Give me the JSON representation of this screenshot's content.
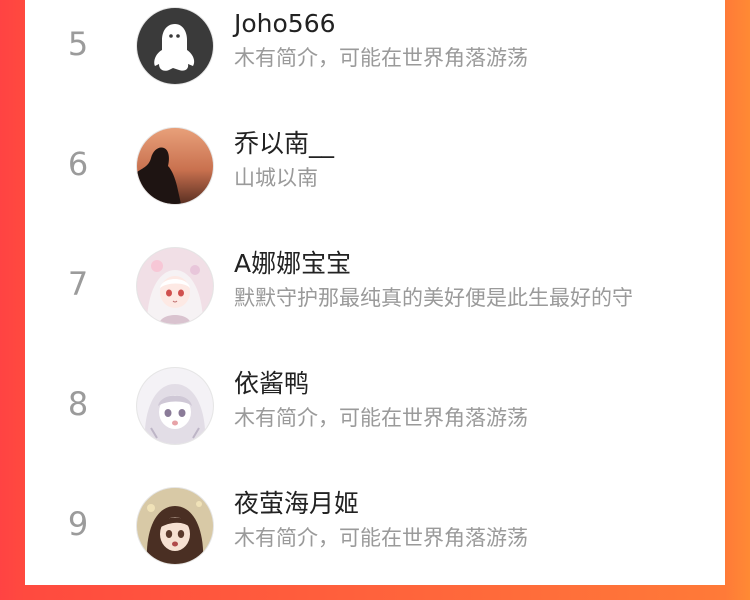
{
  "colors": {
    "gradient_left": "#ff4343",
    "gradient_right": "#ff8a34",
    "rank_text": "#9b9b9b",
    "name_text": "#222222",
    "bio_text": "#9a9a9a"
  },
  "rows": [
    {
      "rank": "5",
      "name": "Joho566",
      "bio": "木有简介，可能在世界角落游荡",
      "avatar_icon": "default-ghost-avatar-icon"
    },
    {
      "rank": "6",
      "name": "乔以南__",
      "bio": "山城以南",
      "avatar_icon": "sunset-silhouette-avatar-icon"
    },
    {
      "rank": "7",
      "name": "A娜娜宝宝",
      "bio": "默默守护那最纯真的美好便是此生最好的守",
      "avatar_icon": "anime-girl-avatar-icon"
    },
    {
      "rank": "8",
      "name": "依酱鸭",
      "bio": "木有简介，可能在世界角落游荡",
      "avatar_icon": "anime-sketch-avatar-icon"
    },
    {
      "rank": "9",
      "name": "夜萤海月姬",
      "bio": "木有简介，可能在世界角落游荡",
      "avatar_icon": "anime-brunette-avatar-icon"
    }
  ]
}
